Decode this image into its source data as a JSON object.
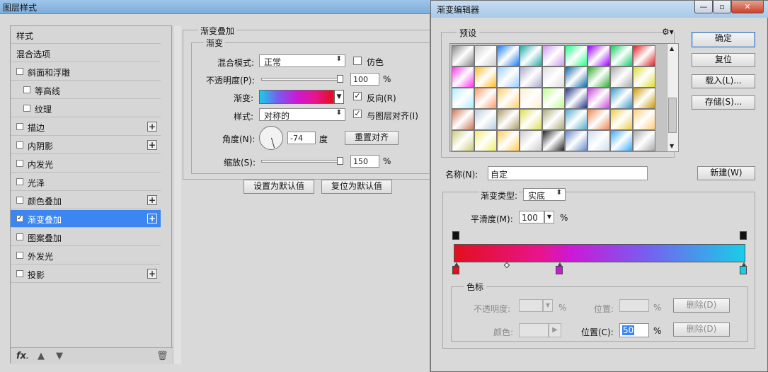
{
  "layer_style": {
    "title": "图层样式",
    "styles_header": "样式",
    "blend_options": "混合选项",
    "items": [
      {
        "label": "斜面和浮雕",
        "checked": false,
        "plus": false
      },
      {
        "label": "等高线",
        "checked": false,
        "plus": false
      },
      {
        "label": "纹理",
        "checked": false,
        "plus": false
      },
      {
        "label": "描边",
        "checked": false,
        "plus": true
      },
      {
        "label": "内阴影",
        "checked": false,
        "plus": true
      },
      {
        "label": "内发光",
        "checked": false,
        "plus": false
      },
      {
        "label": "光泽",
        "checked": false,
        "plus": false
      },
      {
        "label": "颜色叠加",
        "checked": false,
        "plus": true
      },
      {
        "label": "渐变叠加",
        "checked": true,
        "plus": true
      },
      {
        "label": "图案叠加",
        "checked": false,
        "plus": false
      },
      {
        "label": "外发光",
        "checked": false,
        "plus": false
      },
      {
        "label": "投影",
        "checked": false,
        "plus": true
      }
    ],
    "bottom": {
      "fx": "fx",
      "fx_suffix": "."
    },
    "section_title": "渐变叠加",
    "subsection": "渐变",
    "blend_mode_label": "混合模式:",
    "blend_mode_value": "正常",
    "dither_label": "仿色",
    "opacity_label": "不透明度(P):",
    "opacity_value": "100",
    "opacity_unit": "%",
    "gradient_label": "渐变:",
    "reverse_label": "反向(R)",
    "style_label": "样式:",
    "style_value": "对称的",
    "align_label": "与图层对齐(I)",
    "angle_label": "角度(N):",
    "angle_value": "-74",
    "angle_unit": "度",
    "reset_align_button": "重置对齐",
    "scale_label": "缩放(S):",
    "scale_value": "150",
    "scale_unit": "%",
    "make_default_button": "设置为默认值",
    "reset_default_button": "复位为默认值"
  },
  "gradient_editor": {
    "title": "渐变编辑器",
    "presets_label": "预设",
    "ok_button": "确定",
    "reset_button": "复位",
    "load_button": "载入(L)...",
    "save_button": "存储(S)...",
    "name_label": "名称(N):",
    "name_value": "自定",
    "new_button": "新建(W)",
    "type_label": "渐变类型:",
    "type_value": "实底",
    "smooth_label": "平滑度(M):",
    "smooth_value": "100",
    "smooth_unit": "%",
    "stops_group": "色标",
    "stop_opacity_label": "不透明度:",
    "stop_opacity_unit": "%",
    "stop_position_label": "位置:",
    "stop_position_unit": "%",
    "delete_label": "删除(D)",
    "color_label": "颜色:",
    "color_position_label": "位置(C):",
    "color_position_value": "50",
    "color_position_unit": "%",
    "delete_label2": "删除(D)",
    "gradient_colors": [
      "#e20f1e",
      "#e8148f",
      "#cc18d6",
      "#7a5bf0",
      "#19cde8"
    ]
  }
}
